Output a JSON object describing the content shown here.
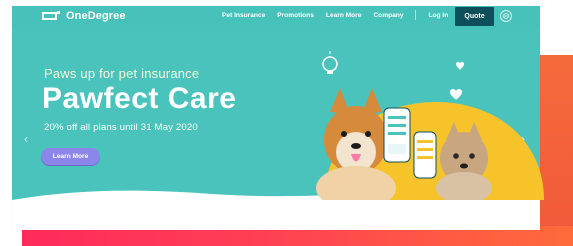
{
  "brand": {
    "name": "OneDegree"
  },
  "nav": {
    "items": [
      "Pet Insurance",
      "Promotions",
      "Learn More",
      "Company",
      "Log In"
    ],
    "quote_label": "Quote",
    "language_icon": "globe-icon"
  },
  "hero": {
    "tagline": "Paws up for pet insurance",
    "headline": "Pawfect Care",
    "offer": "20% off all plans until 31 May 2020",
    "cta_label": "Learn More",
    "prev_icon": "chevron-left-icon",
    "next_icon": "chevron-right-icon"
  },
  "colors": {
    "hero_teal": "#49c3bc",
    "quote_dark": "#0c4f5a",
    "cta_purple": "#8d86ea",
    "accent_orange": "#f46b3b",
    "accent_pink": "#ff2a5b",
    "sun_yellow": "#f6c32b"
  },
  "illustration": {
    "subject": "shiba-dog-and-tabby-cat-with-phones"
  }
}
